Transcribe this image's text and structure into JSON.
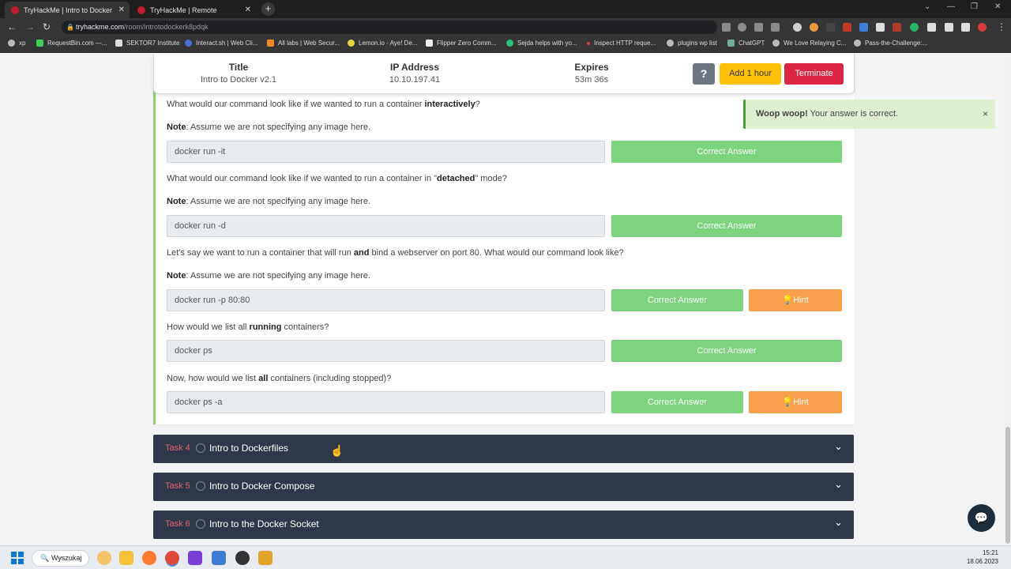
{
  "browser": {
    "tabs": [
      {
        "title": "TryHackMe | Intro to Docker",
        "active": true
      },
      {
        "title": "TryHackMe | Remote",
        "active": false
      }
    ],
    "url_host": "tryhackme.com",
    "url_path": "/room/introtodockerk8pdqk",
    "bookmarks": [
      "xp",
      "RequestBin.com —...",
      "SEKTOR7 Institute",
      "Interact.sh | Web Cli...",
      "All labs | Web Secur...",
      "Lemon.io - Aye! De...",
      "Flipper Zero Comm...",
      "Sejda helps with yo...",
      "Inspect HTTP reque...",
      "plugins wp list",
      "ChatGPT",
      "We Love Relaying C...",
      "Pass-the-Challenge:..."
    ]
  },
  "machine": {
    "title_label": "Title",
    "title_value": "Intro to Docker v2.1",
    "ip_label": "IP Address",
    "ip_value": "10.10.197.41",
    "expires_label": "Expires",
    "expires_value": "53m 36s",
    "help_label": "?",
    "add_hour_label": "Add 1 hour",
    "terminate_label": "Terminate"
  },
  "questions": [
    {
      "pre": "What would our command look like if we wanted to run a container ",
      "bold": "interactively",
      "post": "?",
      "note_label": "Note",
      "note_text": ": Assume we are not specifying any image here.",
      "answer": "docker run -it",
      "status": "Correct Answer"
    },
    {
      "pre": "What would our command look like if we wanted to run a container in \"",
      "bold": "detached",
      "post": "\" mode?",
      "note_label": "Note",
      "note_text": ": Assume we are not specifying any image here.",
      "answer": "docker run -d",
      "status": "Correct Answer"
    },
    {
      "pre": "Let's say we want to run a container that will run ",
      "bold": "and",
      "post": " bind a webserver on port 80. What would our command look like?",
      "note_label": "Note",
      "note_text": ": Assume we are not specifying any image here.",
      "answer": "docker run -p 80:80",
      "status": "Correct Answer",
      "hint": "Hint"
    },
    {
      "pre": "How would we list all ",
      "bold": "running",
      "post": " containers?",
      "answer": "docker ps",
      "status": "Correct Answer"
    },
    {
      "pre": "Now, how would we list ",
      "bold": "all",
      "post": " containers (including stopped)?",
      "answer": "docker ps -a",
      "status": "Correct Answer",
      "hint": "Hint"
    }
  ],
  "tasks": [
    {
      "num": "Task 4",
      "title": "Intro to Dockerfiles"
    },
    {
      "num": "Task 5",
      "title": "Intro to Docker Compose"
    },
    {
      "num": "Task 6",
      "title": "Intro to the Docker Socket"
    }
  ],
  "toast": {
    "bold": "Woop woop!",
    "text": " Your answer is correct.",
    "close": "×"
  },
  "taskbar": {
    "search_label": "Wyszukaj",
    "time": "15:21",
    "date": "18.06.2023"
  },
  "colors": {
    "correct": "#7cd47f",
    "hint": "#f9a04c",
    "terminate": "#dc2443",
    "add_hour": "#ffc107",
    "task_bar": "#2f3848",
    "task_num": "#e0626b"
  }
}
